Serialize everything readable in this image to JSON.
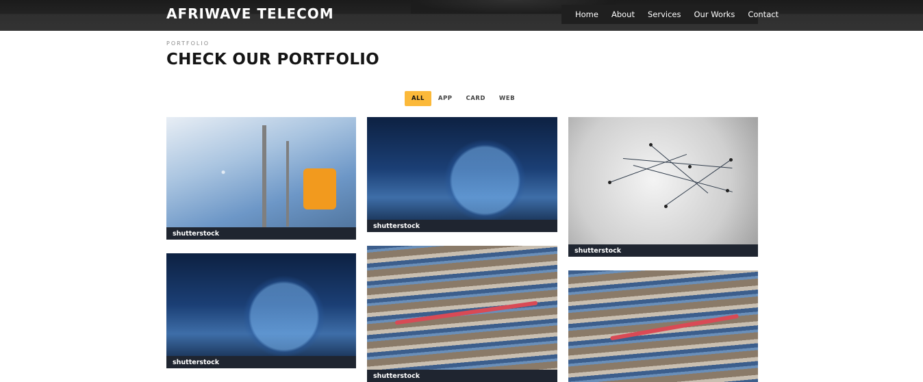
{
  "header": {
    "brand": "AFRIWAVE TELECOM",
    "nav": [
      "Home",
      "About",
      "Services",
      "Our Works",
      "Contact"
    ]
  },
  "section": {
    "kicker": "PORTFOLIO",
    "title": "CHECK OUR PORTFOLIO"
  },
  "filters": {
    "items": [
      "ALL",
      "APP",
      "CARD",
      "WEB"
    ],
    "active": "ALL",
    "active_color": "#fbb93a"
  },
  "portfolio": {
    "watermark": "shutterstock",
    "items": [
      {
        "subject": "telecom-tower-engineer"
      },
      {
        "subject": "digital-globe-network"
      },
      {
        "subject": "string-network-pins"
      },
      {
        "subject": "digital-globe-network"
      },
      {
        "subject": "server-rack-cables"
      },
      {
        "subject": "server-rack-cables"
      }
    ]
  },
  "colors": {
    "header_bg": "#2f2f2f",
    "nav_bg": "#1f1f1f",
    "title": "#151515"
  }
}
